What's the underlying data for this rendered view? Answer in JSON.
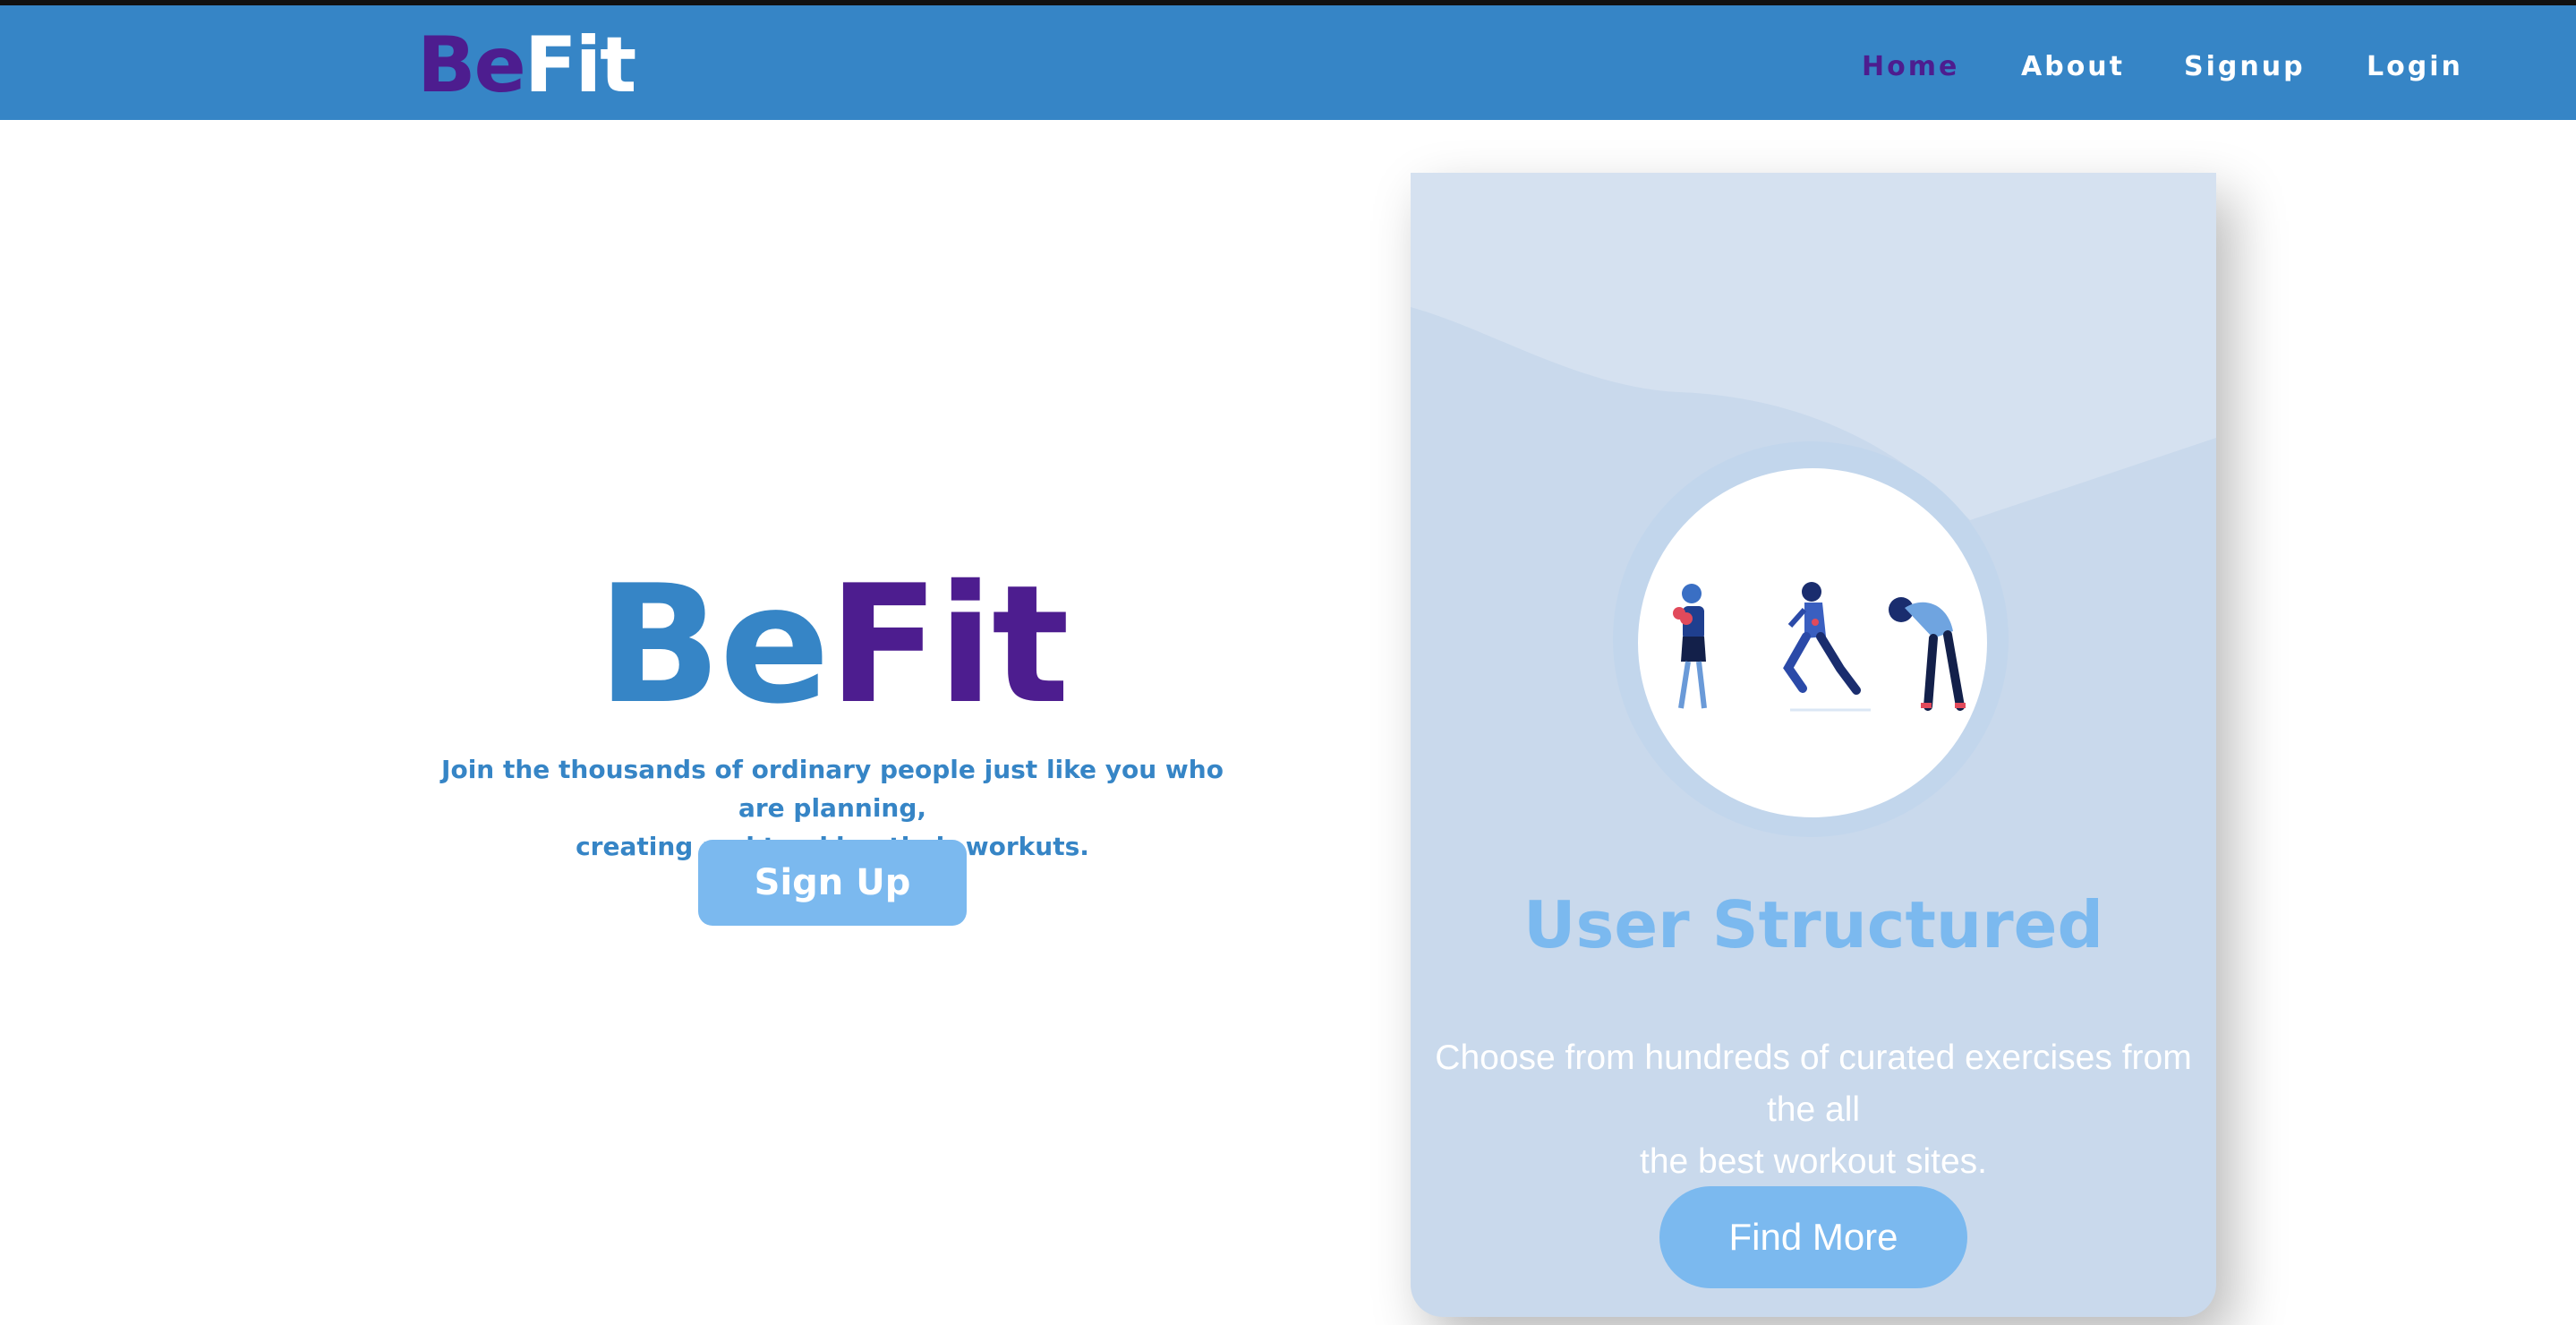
{
  "header": {
    "brand_be": "Be",
    "brand_fit": "Fit",
    "nav": [
      {
        "label": "Home",
        "active": true
      },
      {
        "label": "About",
        "active": false
      },
      {
        "label": "Signup",
        "active": false
      },
      {
        "label": "Login",
        "active": false
      }
    ]
  },
  "hero": {
    "title_be": "Be",
    "title_fit": "Fit",
    "subtitle_line1": "Join the thousands of ordinary people just like you who are planning,",
    "subtitle_line2": "creating and tracking their workuts.",
    "cta_label": "Sign Up"
  },
  "feature_card": {
    "title": "User Structured",
    "text_line1": "Choose from hundreds of curated exercises from the all",
    "text_line2": "the best workout sites.",
    "button_label": "Find More",
    "illustration": "three-people-exercising-illustration"
  },
  "colors": {
    "primary_blue": "#3685c6",
    "accent_purple": "#4d1d8f",
    "light_blue": "#7bb9ef",
    "card_bg": "#c9d9ec"
  }
}
